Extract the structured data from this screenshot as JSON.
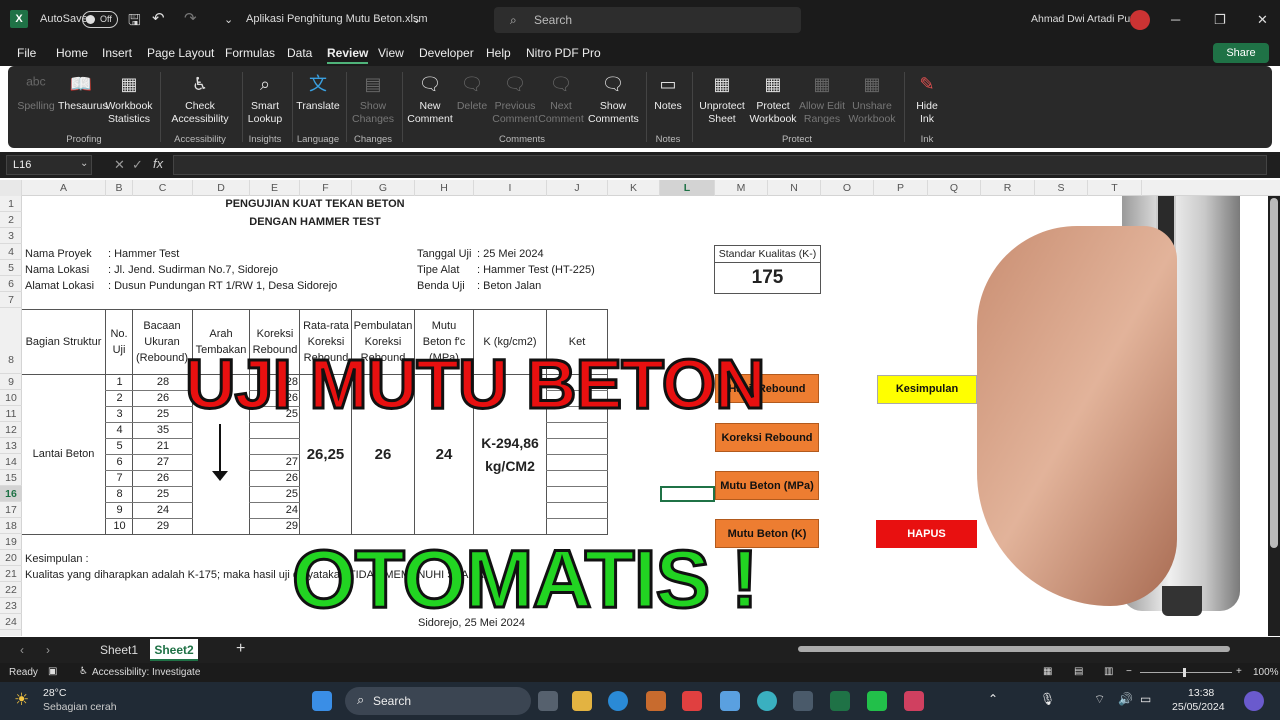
{
  "titlebar": {
    "app_icon": "X",
    "autosave_label": "AutoSave",
    "autosave_state": "Off",
    "filename": "Aplikasi Penghitung Mutu Beton.xlsm",
    "search_placeholder": "Search",
    "user": "Ahmad Dwi Artadi Putra"
  },
  "menu": [
    "File",
    "Home",
    "Insert",
    "Page Layout",
    "Formulas",
    "Data",
    "Review",
    "View",
    "Developer",
    "Help",
    "Nitro PDF Pro"
  ],
  "menu_active": "Review",
  "share_label": "Share",
  "ribbon": {
    "groups": [
      {
        "label": "Proofing",
        "buttons": [
          {
            "label": "Spelling",
            "icon": "abc-icon",
            "enabled": false
          },
          {
            "label": "Thesaurus",
            "icon": "book-icon",
            "enabled": true
          },
          {
            "label": "Workbook Statistics",
            "icon": "stats-icon",
            "enabled": true
          }
        ]
      },
      {
        "label": "Accessibility",
        "buttons": [
          {
            "label": "Check Accessibility",
            "icon": "accessibility-icon",
            "enabled": true
          }
        ]
      },
      {
        "label": "Insights",
        "buttons": [
          {
            "label": "Smart Lookup",
            "icon": "lightbulb-icon",
            "enabled": true
          }
        ]
      },
      {
        "label": "Language",
        "buttons": [
          {
            "label": "Translate",
            "icon": "translate-icon",
            "enabled": true
          }
        ]
      },
      {
        "label": "Changes",
        "buttons": [
          {
            "label": "Show Changes",
            "icon": "changes-icon",
            "enabled": false
          }
        ]
      },
      {
        "label": "Comments",
        "buttons": [
          {
            "label": "New Comment",
            "icon": "comment-icon",
            "enabled": true
          },
          {
            "label": "Delete",
            "icon": "delete-icon",
            "enabled": false
          },
          {
            "label": "Previous Comment",
            "icon": "prev-icon",
            "enabled": false
          },
          {
            "label": "Next Comment",
            "icon": "next-icon",
            "enabled": false
          },
          {
            "label": "Show Comments",
            "icon": "comments-icon",
            "enabled": true
          }
        ]
      },
      {
        "label": "Notes",
        "buttons": [
          {
            "label": "Notes",
            "icon": "note-icon",
            "enabled": true
          }
        ]
      },
      {
        "label": "Protect",
        "buttons": [
          {
            "label": "Unprotect Sheet",
            "icon": "unlock-icon",
            "enabled": true
          },
          {
            "label": "Protect Workbook",
            "icon": "lock-icon",
            "enabled": true
          },
          {
            "label": "Allow Edit Ranges",
            "icon": "range-icon",
            "enabled": false
          },
          {
            "label": "Unshare Workbook",
            "icon": "unshare-icon",
            "enabled": false
          }
        ]
      },
      {
        "label": "Ink",
        "buttons": [
          {
            "label": "Hide Ink",
            "icon": "pen-icon",
            "enabled": true
          }
        ]
      }
    ]
  },
  "namebox": "L16",
  "columns": [
    "A",
    "B",
    "C",
    "D",
    "E",
    "F",
    "G",
    "H",
    "I",
    "J",
    "K",
    "L",
    "M",
    "N",
    "O",
    "P",
    "Q",
    "R",
    "S",
    "T"
  ],
  "rows": [
    "1",
    "2",
    "3",
    "4",
    "5",
    "6",
    "7",
    "8",
    "9",
    "10",
    "11",
    "12",
    "13",
    "14",
    "15",
    "16",
    "17",
    "18",
    "19",
    "20",
    "21",
    "22",
    "23",
    "24"
  ],
  "sheet": {
    "title1": "PENGUJIAN KUAT TEKAN BETON",
    "title2": "DENGAN HAMMER TEST",
    "info": [
      {
        "label": "Nama Proyek",
        "value": ": Hammer Test"
      },
      {
        "label": "Nama Lokasi",
        "value": ": Jl. Jend. Sudirman No.7, Sidorejo"
      },
      {
        "label": "Alamat Lokasi",
        "value": ": Dusun Pundungan RT 1/RW 1, Desa Sidorejo"
      }
    ],
    "info_right": [
      {
        "label": "Tanggal Uji",
        "value": ": 25 Mei 2024"
      },
      {
        "label": "Tipe Alat",
        "value": ": Hammer Test (HT-225)"
      },
      {
        "label": "Benda Uji",
        "value": ": Beton Jalan"
      }
    ],
    "standard_label": "Standar Kualitas (K-)",
    "standard_value": "175",
    "headers": {
      "struktur": "Bagian Struktur",
      "no": "No. Uji",
      "bacaan": "Bacaan Ukuran (Rebound)",
      "arah": "Arah Tembakan",
      "koreksi": "Koreksi Rebound",
      "rata": "Rata-rata Koreksi Rebound",
      "pembulatan": "Pembulatan Koreksi Rebound",
      "mutu": "Mutu Beton f'c (MPa)",
      "k": "K (kg/cm2)",
      "ket": "Ket"
    },
    "struktur_value": "Lantai Beton",
    "no_uji": [
      "1",
      "2",
      "3",
      "4",
      "5",
      "6",
      "7",
      "8",
      "9",
      "10"
    ],
    "bacaan": [
      "28",
      "26",
      "25",
      "35",
      "21",
      "27",
      "26",
      "25",
      "24",
      "29"
    ],
    "koreksi": [
      "28",
      "26",
      "25",
      "",
      "",
      "27",
      "26",
      "25",
      "24",
      "29"
    ],
    "rata": "26,25",
    "pembulatan": "26",
    "mutu": "24",
    "k_value": "K-294,86",
    "k_unit": "kg/CM2",
    "kesimpulan_label": "Kesimpulan :",
    "kesimpulan_text": "Kualitas yang diharapkan adalah K-175; maka hasil uji dinyatakan TIDAK MEMENUHI SYARAT",
    "footer_text": "Sidorejo, 25 Mei 2024",
    "buttons": {
      "hasil": "Hasil Rebound",
      "koreksi": "Koreksi Rebound",
      "mutu_mpa": "Mutu Beton (MPa)",
      "mutu_k": "Mutu Beton (K)",
      "kesimpulan": "Kesimpulan",
      "hapus": "HAPUS"
    }
  },
  "overlay": {
    "line1": "UJI MUTU BETON",
    "line2": "OTOMATIS !"
  },
  "sheet_tabs": [
    "Sheet1",
    "Sheet2"
  ],
  "active_tab": "Sheet2",
  "status": {
    "ready": "Ready",
    "accessibility": "Accessibility: Investigate",
    "zoom": "100%"
  },
  "taskbar": {
    "temp": "28°C",
    "weather": "Sebagian cerah",
    "search": "Search",
    "time": "13:38",
    "date": "25/05/2024"
  },
  "colors": {
    "accent_green": "#1f7246",
    "button_orange": "#ed7d31",
    "yellow": "#ffff00",
    "red": "#e81010",
    "overlay_green": "#22d422"
  }
}
